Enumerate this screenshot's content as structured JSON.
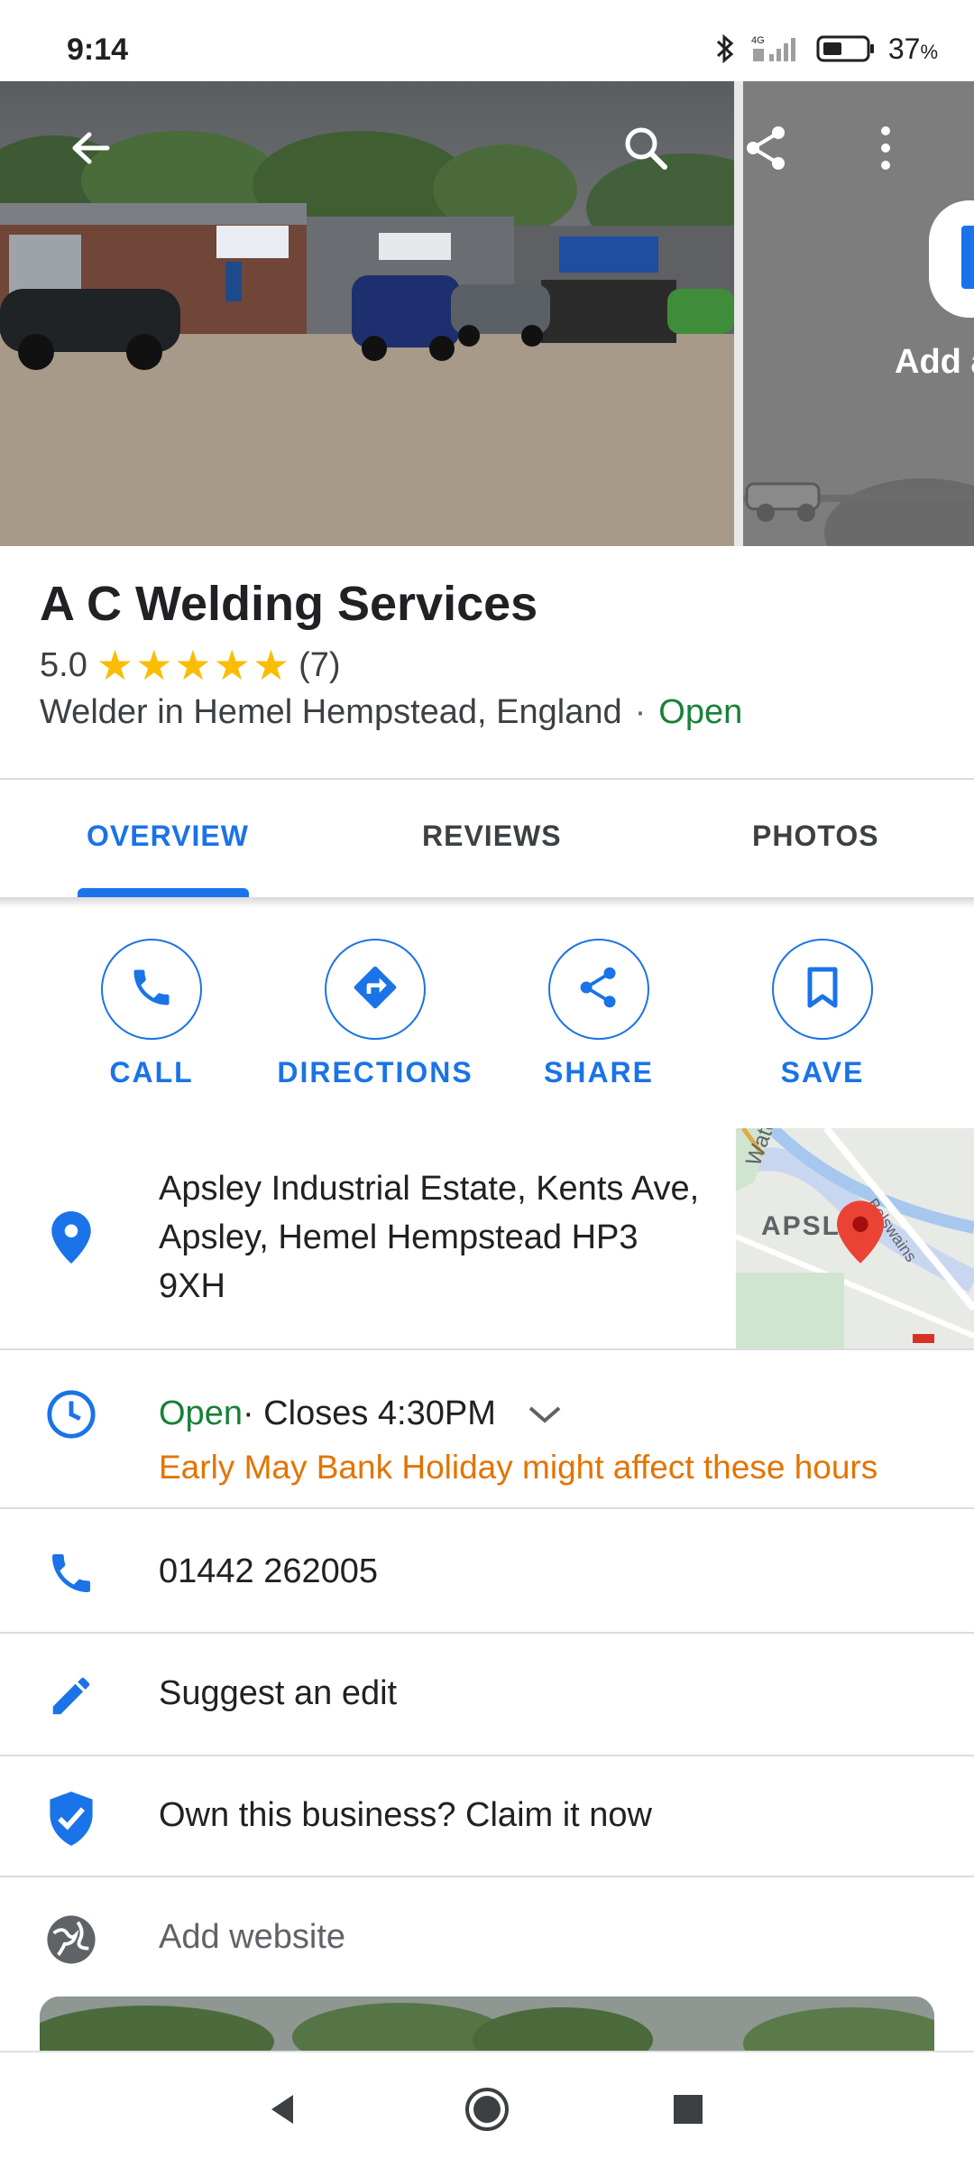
{
  "status_bar": {
    "time": "9:14",
    "network": "4G",
    "battery_percent": "37",
    "battery_unit": "%"
  },
  "hero": {
    "add_photo_label": "Add a",
    "icons": [
      "back-arrow-icon",
      "search-icon",
      "share-icon",
      "more-vert-icon"
    ]
  },
  "place": {
    "name": "A C Welding Services",
    "rating": "5.0",
    "stars": 5,
    "review_count": "(7)",
    "category": "Welder in Hemel Hempstead, England",
    "separator": "·",
    "status": "Open"
  },
  "tabs": [
    {
      "label": "OVERVIEW",
      "active": true
    },
    {
      "label": "REVIEWS",
      "active": false
    },
    {
      "label": "PHOTOS",
      "active": false
    }
  ],
  "actions": [
    {
      "label": "CALL",
      "icon": "phone-icon"
    },
    {
      "label": "DIRECTIONS",
      "icon": "directions-icon"
    },
    {
      "label": "SHARE",
      "icon": "share-icon"
    },
    {
      "label": "SAVE",
      "icon": "bookmark-icon"
    }
  ],
  "address": {
    "line1": "Apsley Industrial Estate, Kents Ave,",
    "line2": "Apsley, Hemel Hempstead HP3",
    "line3": "9XH"
  },
  "map": {
    "label_area": "APSL",
    "label_road": "Belswains Ln",
    "label_water": "Wate"
  },
  "hours": {
    "status": "Open",
    "closes": " · Closes 4:30PM",
    "note": "Early May Bank Holiday might affect these hours"
  },
  "phone": "01442 262005",
  "suggest_edit": "Suggest an edit",
  "claim": "Own this business? Claim it now",
  "website": "Add website",
  "colors": {
    "accent": "#1a73e8",
    "open": "#188038",
    "warning": "#e37400",
    "star": "#fbbc04"
  }
}
